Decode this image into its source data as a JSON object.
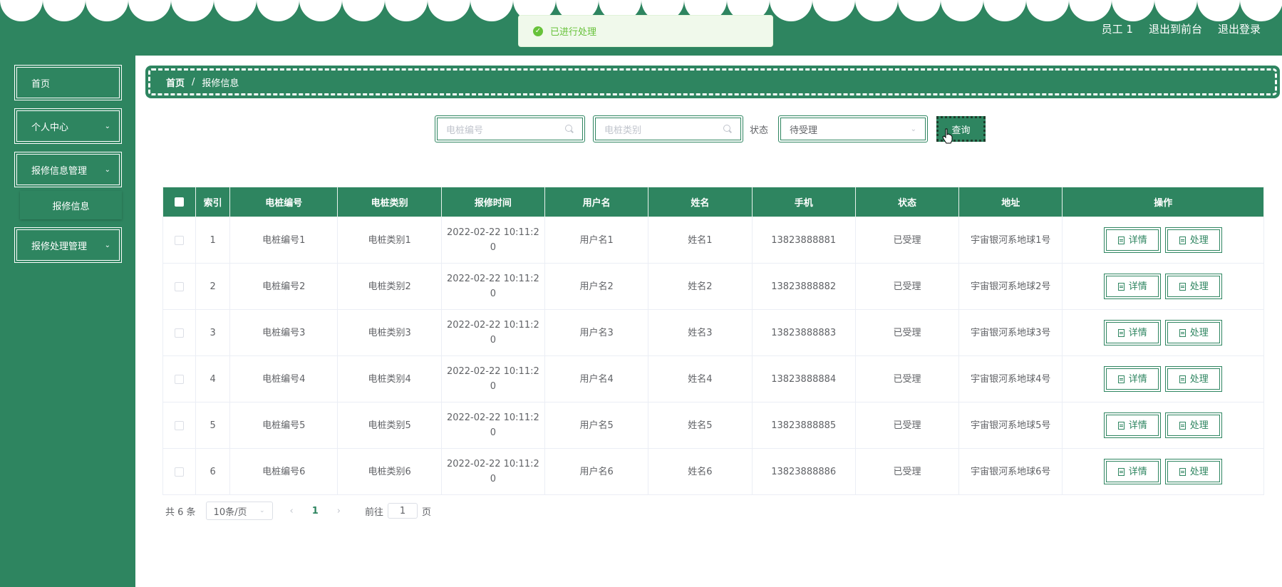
{
  "header": {
    "user_label": "员工 1",
    "front_label": "退出到前台",
    "logout_label": "退出登录"
  },
  "toast": {
    "icon": "check-icon",
    "message": "已进行处理"
  },
  "sidebar": {
    "items": [
      {
        "label": "首页"
      },
      {
        "label": "个人中心"
      },
      {
        "label": "报修信息管理"
      },
      {
        "label": "报修处理管理"
      }
    ],
    "submenu": {
      "label": "报修信息"
    }
  },
  "breadcrumb": {
    "home": "首页",
    "separator": "/",
    "current": "报修信息"
  },
  "search": {
    "pile_no_placeholder": "电桩编号",
    "pile_type_placeholder": "电桩类别",
    "status_label": "状态",
    "status_value": "待受理",
    "query_label": "查询"
  },
  "table": {
    "headers": [
      "",
      "索引",
      "电桩编号",
      "电桩类别",
      "报修时间",
      "用户名",
      "姓名",
      "手机",
      "状态",
      "地址",
      "操作"
    ],
    "detail_label": "详情",
    "process_label": "处理",
    "rows": [
      {
        "index": "1",
        "pile_no": "电桩编号1",
        "pile_type": "电桩类别1",
        "time_a": "2022-02-22 10:11:2",
        "time_b": "0",
        "username": "用户名1",
        "name": "姓名1",
        "phone": "13823888881",
        "status": "已受理",
        "address": "宇宙银河系地球1号"
      },
      {
        "index": "2",
        "pile_no": "电桩编号2",
        "pile_type": "电桩类别2",
        "time_a": "2022-02-22 10:11:2",
        "time_b": "0",
        "username": "用户名2",
        "name": "姓名2",
        "phone": "13823888882",
        "status": "已受理",
        "address": "宇宙银河系地球2号"
      },
      {
        "index": "3",
        "pile_no": "电桩编号3",
        "pile_type": "电桩类别3",
        "time_a": "2022-02-22 10:11:2",
        "time_b": "0",
        "username": "用户名3",
        "name": "姓名3",
        "phone": "13823888883",
        "status": "已受理",
        "address": "宇宙银河系地球3号"
      },
      {
        "index": "4",
        "pile_no": "电桩编号4",
        "pile_type": "电桩类别4",
        "time_a": "2022-02-22 10:11:2",
        "time_b": "0",
        "username": "用户名4",
        "name": "姓名4",
        "phone": "13823888884",
        "status": "已受理",
        "address": "宇宙银河系地球4号"
      },
      {
        "index": "5",
        "pile_no": "电桩编号5",
        "pile_type": "电桩类别5",
        "time_a": "2022-02-22 10:11:2",
        "time_b": "0",
        "username": "用户名5",
        "name": "姓名5",
        "phone": "13823888885",
        "status": "已受理",
        "address": "宇宙银河系地球5号"
      },
      {
        "index": "6",
        "pile_no": "电桩编号6",
        "pile_type": "电桩类别6",
        "time_a": "2022-02-22 10:11:2",
        "time_b": "0",
        "username": "用户名6",
        "name": "姓名6",
        "phone": "13823888886",
        "status": "已受理",
        "address": "宇宙银河系地球6号"
      }
    ]
  },
  "pagination": {
    "total_label": "共 6 条",
    "page_size": "10条/页",
    "current_page": "1",
    "goto_label": "前往",
    "goto_value": "1",
    "page_suffix": "页"
  },
  "colors": {
    "primary": "#2e8560",
    "toast_bg": "#f0f9eb",
    "toast_text": "#67c23a"
  }
}
